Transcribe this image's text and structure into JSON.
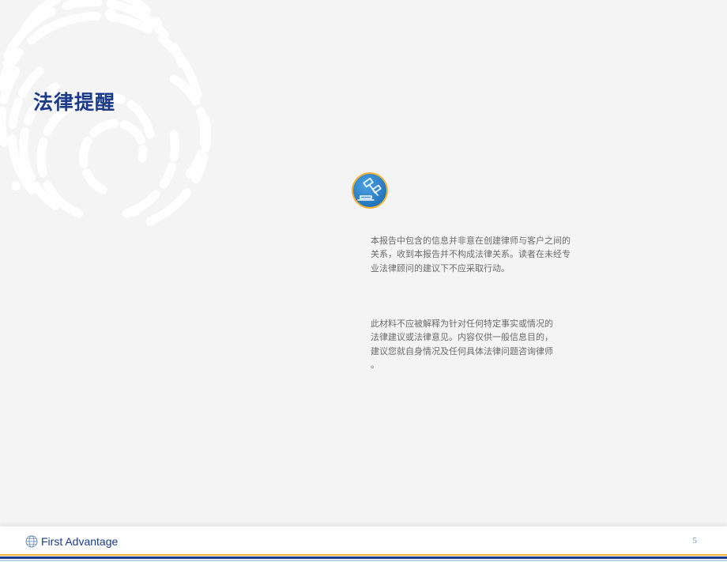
{
  "page": {
    "title": "法律提醒"
  },
  "content": {
    "paragraph_1": "本报告中包含的信息并非意在创建律师与客户之间的\n关系，收到本报告并不构成法律关系。读者在未经专\n业法律顾问的建议下不应采取行动。",
    "paragraph_2": "此材料不应被解释为针对任何特定事实或情况的\n法律建议或法律意见。内容仅供一般信息目的，\n建议您就自身情况及任何具体法律问题咨询律师\n。"
  },
  "footer": {
    "brand": "First Advantage",
    "page_number": "5"
  },
  "icons": {
    "badge": "gavel-icon",
    "background": "fingerprint-pattern",
    "logo": "globe-logo-icon"
  },
  "colors": {
    "title": "#1b3a8a",
    "body_text": "#6b6b6b",
    "badge_fill": "#2a7fc7",
    "badge_ring": "#f2b233",
    "stripe_gold": "#f2b233",
    "stripe_blue": "#1b3a8a",
    "stripe_light": "#bcd3ea"
  }
}
